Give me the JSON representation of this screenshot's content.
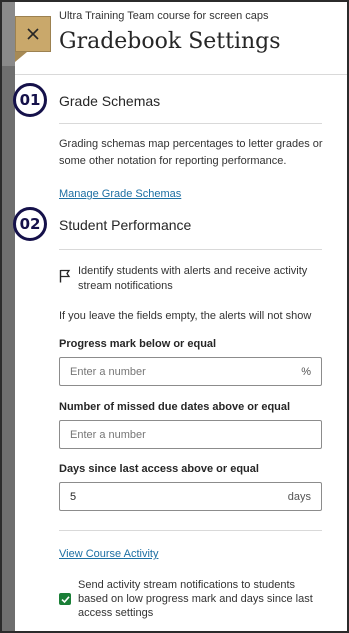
{
  "header": {
    "course_name": "Ultra Training Team course for screen caps",
    "title": "Gradebook Settings",
    "close_icon": "close-icon"
  },
  "colors": {
    "accent_tab": "#c9a86b",
    "badge": "#15114a",
    "link": "#1d6fa3",
    "checkbox": "#1a7f37"
  },
  "sections": [
    {
      "step": "01",
      "title": "Grade Schemas",
      "description": "Grading schemas map percentages to letter grades or some other notation for reporting performance.",
      "link": "Manage Grade Schemas"
    },
    {
      "step": "02",
      "title": "Student Performance"
    }
  ],
  "performance": {
    "alerts_text": "Identify students with alerts and receive activity stream notifications",
    "empty_note": "If you leave the fields empty, the alerts will not show",
    "progress": {
      "label": "Progress mark below or equal",
      "placeholder": "Enter a number",
      "value": "",
      "suffix": "%"
    },
    "missed": {
      "label": "Number of missed due dates above or equal",
      "placeholder": "Enter a number",
      "value": ""
    },
    "days": {
      "label": "Days since last access above or equal",
      "value": "5",
      "suffix": "days"
    },
    "view_link": "View Course Activity",
    "notify_text": "Send activity stream notifications to students based on low progress mark and days since last access settings",
    "notify_checked": true
  }
}
